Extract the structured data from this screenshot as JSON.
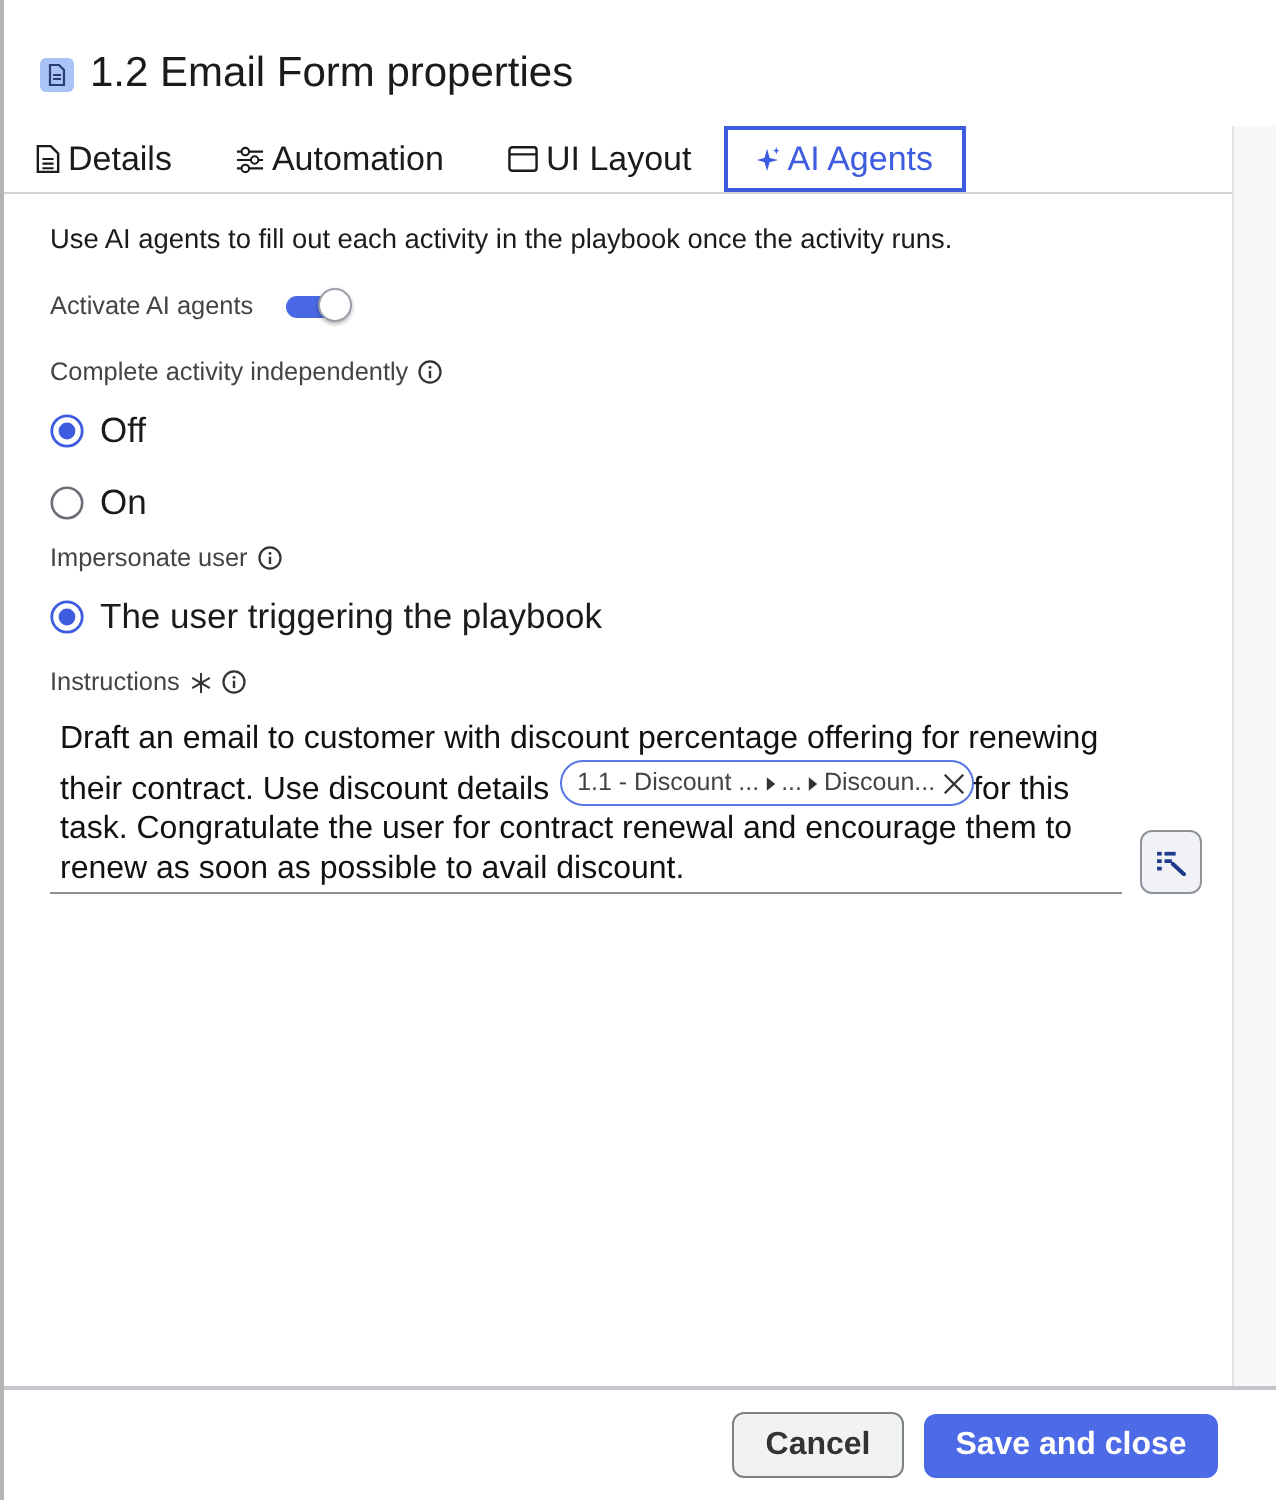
{
  "dialog": {
    "title": "1.2 Email Form properties"
  },
  "tabs": [
    {
      "label": "Details",
      "selected": false
    },
    {
      "label": "Automation",
      "selected": false
    },
    {
      "label": "UI Layout",
      "selected": false
    },
    {
      "label": "AI Agents",
      "selected": true
    }
  ],
  "description": "Use AI agents to fill out each activity in the playbook once the activity runs.",
  "activate_ai_agents": {
    "label": "Activate AI agents",
    "on": true
  },
  "complete_activity_independently": {
    "label": "Complete activity independently",
    "options": [
      {
        "label": "Off",
        "selected": true
      },
      {
        "label": "On",
        "selected": false
      }
    ]
  },
  "impersonate_user": {
    "label": "Impersonate user",
    "options": [
      {
        "label": "The user triggering the playbook",
        "selected": true
      }
    ]
  },
  "instructions": {
    "label": "Instructions",
    "required": true,
    "text_before": "Draft an email to customer with discount percentage offering for renewing their contract. Use discount details",
    "token": {
      "segments": [
        "1.1 - Discount ...",
        "...",
        "Discoun..."
      ]
    },
    "text_after": "for this task. Congratulate the user for contract renewal and encourage them to renew as soon as possible to avail discount."
  },
  "buttons": [
    {
      "label": "Cancel",
      "kind": "secondary"
    },
    {
      "label": "Save and close",
      "kind": "primary"
    }
  ]
}
